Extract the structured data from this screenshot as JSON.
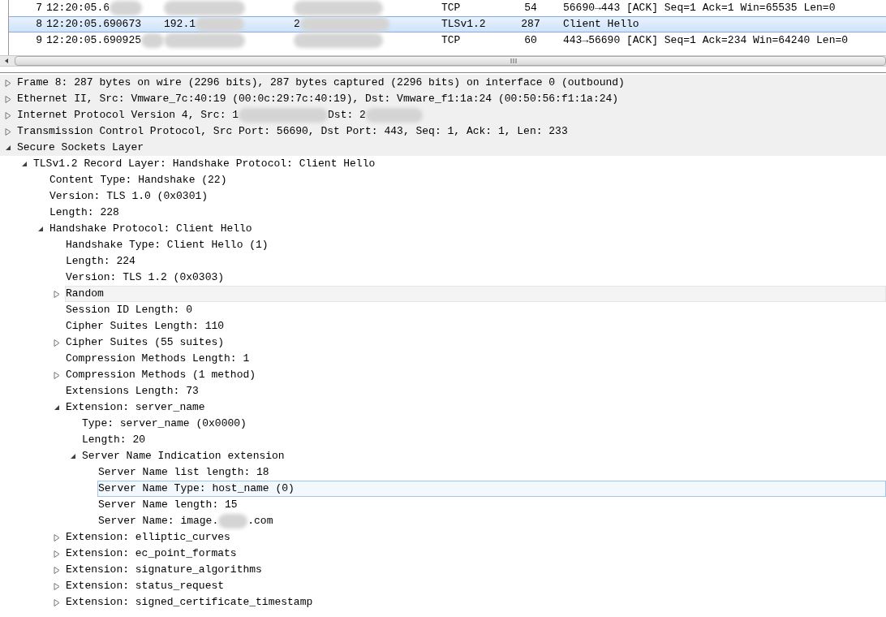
{
  "packet_list": {
    "rows": [
      {
        "no": "7",
        "time": "12:20:05.6",
        "source": "",
        "destination": "",
        "protocol": "TCP",
        "length": "54",
        "info": "56690→443 [ACK] Seq=1 Ack=1 Win=65535 Len=0",
        "redacted": true,
        "selected": false
      },
      {
        "no": "8",
        "time": "12:20:05.690673",
        "source": "192.1",
        "destination": "2",
        "protocol": "TLSv1.2",
        "length": "287",
        "info": "Client Hello",
        "redacted": true,
        "selected": true
      },
      {
        "no": "9",
        "time": "12:20:05.690925",
        "source": "",
        "destination": "",
        "protocol": "TCP",
        "length": "60",
        "info": "443→56690 [ACK] Seq=1 Ack=234 Win=64240 Len=0",
        "redacted": true,
        "selected": false
      }
    ]
  },
  "details": [
    {
      "text": "Frame 8: 287 bytes on wire (2296 bits), 287 bytes captured (2296 bits) on interface 0 (outbound)",
      "expanded": false,
      "selected": false
    },
    {
      "text": "Ethernet II, Src: Vmware_7c:40:19 (00:0c:29:7c:40:19), Dst: Vmware_f1:1a:24 (00:50:56:f1:1a:24)",
      "expanded": false,
      "selected": false
    },
    {
      "text": "Internet Protocol Version 4, Src: 1",
      "text_after": "Dst: 2",
      "redacted": true,
      "expanded": false,
      "selected": false
    },
    {
      "text": "Transmission Control Protocol, Src Port: 56690, Dst Port: 443, Seq: 1, Ack: 1, Len: 233",
      "expanded": false,
      "selected": false
    },
    {
      "text": "Secure Sockets Layer",
      "expanded": true,
      "selected": false,
      "children": [
        {
          "text": "TLSv1.2 Record Layer: Handshake Protocol: Client Hello",
          "expanded": true,
          "selected": false,
          "children": [
            {
              "text": "Content Type: Handshake (22)",
              "selected": false
            },
            {
              "text": "Version: TLS 1.0 (0x0301)",
              "selected": false
            },
            {
              "text": "Length: 228",
              "selected": false
            },
            {
              "text": "Handshake Protocol: Client Hello",
              "expanded": true,
              "selected": false,
              "children": [
                {
                  "text": "Handshake Type: Client Hello (1)",
                  "selected": false
                },
                {
                  "text": "Length: 224",
                  "selected": false
                },
                {
                  "text": "Version: TLS 1.2 (0x0303)",
                  "selected": false
                },
                {
                  "text": "Random",
                  "expanded": false,
                  "hovered": true,
                  "selected": false
                },
                {
                  "text": "Session ID Length: 0",
                  "selected": false
                },
                {
                  "text": "Cipher Suites Length: 110",
                  "selected": false
                },
                {
                  "text": "Cipher Suites (55 suites)",
                  "expanded": false,
                  "selected": false
                },
                {
                  "text": "Compression Methods Length: 1",
                  "selected": false
                },
                {
                  "text": "Compression Methods (1 method)",
                  "expanded": false,
                  "selected": false
                },
                {
                  "text": "Extensions Length: 73",
                  "selected": false
                },
                {
                  "text": "Extension: server_name",
                  "expanded": true,
                  "selected": false,
                  "children": [
                    {
                      "text": "Type: server_name (0x0000)",
                      "selected": false
                    },
                    {
                      "text": "Length: 20",
                      "selected": false
                    },
                    {
                      "text": "Server Name Indication extension",
                      "expanded": true,
                      "selected": false,
                      "children": [
                        {
                          "text": "Server Name list length: 18",
                          "selected": false
                        },
                        {
                          "text": "Server Name Type: host_name (0)",
                          "selected": true
                        },
                        {
                          "text": "Server Name length: 15",
                          "selected": false
                        },
                        {
                          "text": "Server Name: image.",
                          "text_after": ".com",
                          "redacted": true,
                          "selected": false
                        }
                      ]
                    }
                  ]
                },
                {
                  "text": "Extension: elliptic_curves",
                  "expanded": false,
                  "selected": false
                },
                {
                  "text": "Extension: ec_point_formats",
                  "expanded": false,
                  "selected": false
                },
                {
                  "text": "Extension: signature_algorithms",
                  "expanded": false,
                  "selected": false
                },
                {
                  "text": "Extension: status_request",
                  "expanded": false,
                  "selected": false
                },
                {
                  "text": "Extension: signed_certificate_timestamp",
                  "expanded": false,
                  "selected": false
                }
              ]
            }
          ]
        }
      ]
    }
  ]
}
